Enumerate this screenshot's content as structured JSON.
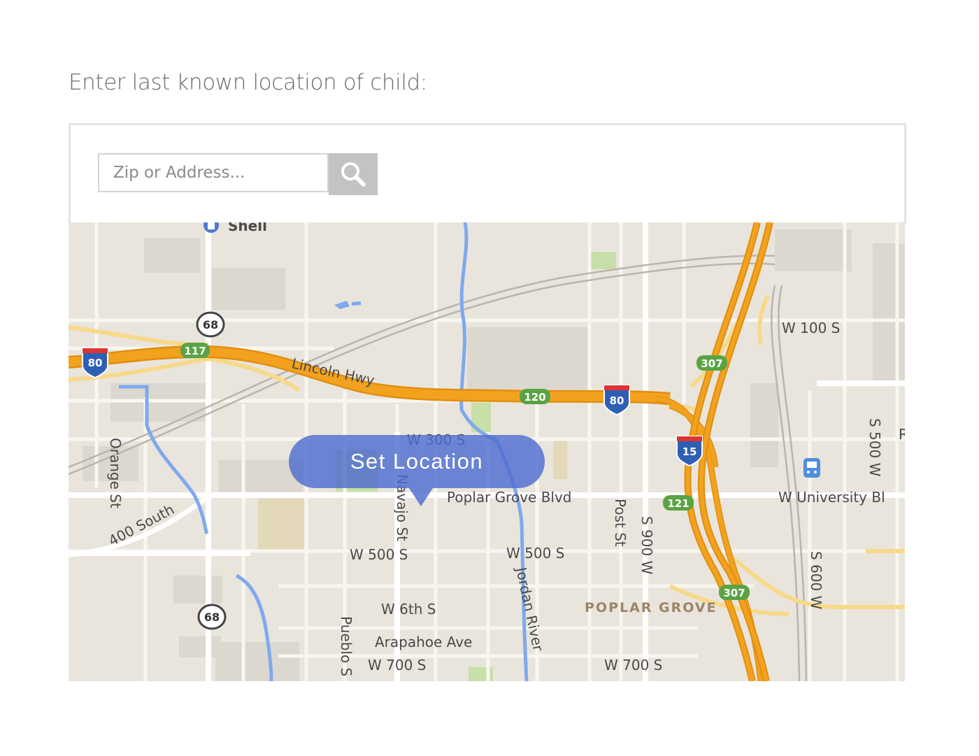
{
  "prompt": {
    "text": "Enter last known location of child:"
  },
  "search": {
    "placeholder": "Zip or Address...",
    "value": "",
    "icon": "search-icon"
  },
  "map": {
    "set_location_label": "Set Location",
    "streets": {
      "shell": "Shell",
      "lincoln_hwy": "Lincoln Hwy",
      "w100s": "W 100 S",
      "w300s": "W 300 S",
      "orange_st": "Orange St",
      "navajo_st": "Navajo St",
      "poplar_grove_blvd": "Poplar Grove Blvd",
      "post_st": "Post St",
      "s900w": "S 900 W",
      "w_university": "W University Bl",
      "s500w": "S 500 W",
      "south400": "400 South",
      "w500s_a": "W 500 S",
      "w500s_b": "W 500 S",
      "jordan_river": "Jordan River",
      "poplar_grove": "POPLAR GROVE",
      "w6ths": "W 6th S",
      "arapahoe_ave": "Arapahoe Ave",
      "pueblo_st": "Pueblo S",
      "w700s_a": "W 700 S",
      "w700s_b": "W 700 S",
      "s600w": "S 600 W",
      "edge_r": "R"
    },
    "shields": {
      "i80_a": "80",
      "i80_b": "80",
      "i15": "15",
      "us68_a": "68",
      "us68_b": "68",
      "exit117": "117",
      "exit120": "120",
      "exit121": "121",
      "exit307_a": "307",
      "exit307_b": "307"
    },
    "colors": {
      "land": "#e9e5dc",
      "highway": "#f2a21e",
      "highway_edge": "#e08e10",
      "major_road": "#f7d98a",
      "water": "#7fa9ee",
      "park": "#c7dfa8",
      "button": "#4e6cd0"
    }
  }
}
